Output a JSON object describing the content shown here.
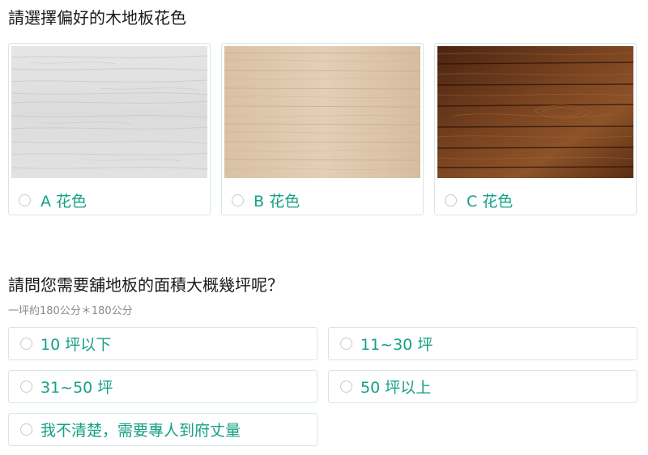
{
  "question1": {
    "title": "請選擇偏好的木地板花色",
    "options": [
      {
        "label": "A 花色",
        "swatch": "white-oak",
        "color": "#dcdcdc"
      },
      {
        "label": "B 花色",
        "swatch": "light-ash",
        "color": "#ddc6ab"
      },
      {
        "label": "C 花色",
        "swatch": "dark-walnut",
        "color": "#6e3c1c"
      }
    ]
  },
  "question2": {
    "title": "請問您需要舖地板的面積大概幾坪呢？",
    "hint": "一坪約180公分＊180公分",
    "options": [
      {
        "label": "10 坪以下"
      },
      {
        "label": "11~30 坪"
      },
      {
        "label": "31~50 坪"
      },
      {
        "label": "50 坪以上"
      },
      {
        "label": "我不清楚，需要專人到府丈量"
      }
    ]
  },
  "colors": {
    "accent": "#16a085",
    "border": "#d7e7e6",
    "hint": "#8a8a8a"
  }
}
